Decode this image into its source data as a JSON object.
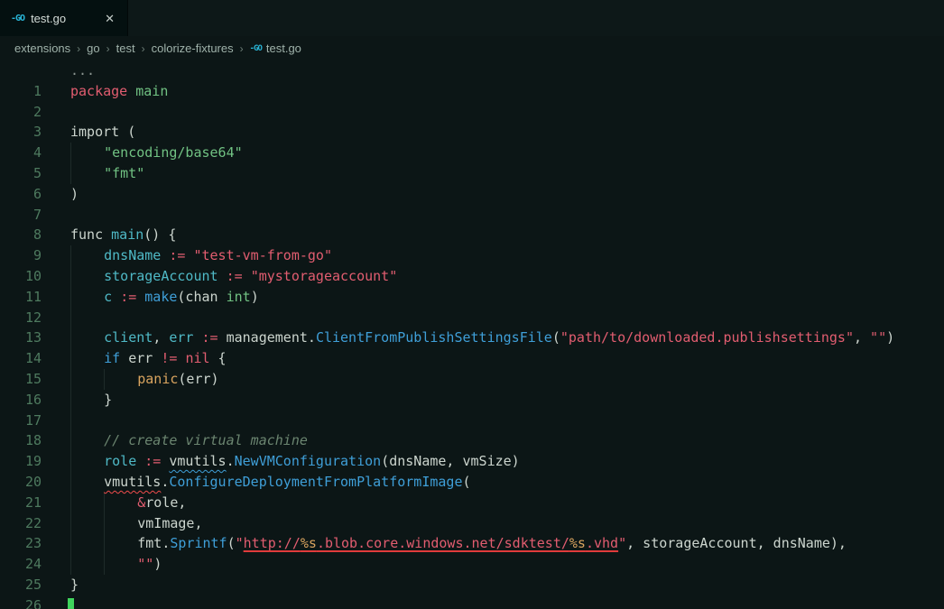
{
  "tab": {
    "title": "test.go",
    "close_glyph": "✕"
  },
  "icons": {
    "go_glyph": "-GO"
  },
  "breadcrumb": {
    "items": [
      "extensions",
      "go",
      "test",
      "colorize-fixtures"
    ],
    "file": "test.go",
    "separator": "›"
  },
  "colors": {
    "editor_bg": "#0c1616",
    "tab_bg": "#041010",
    "go_brand": "#29b6d8",
    "keyword_red": "#e25d70",
    "string_red": "#e25d70",
    "green": "#71c283",
    "teal_variable": "#4fb9c6",
    "blue_function": "#3f9fd8",
    "orange": "#d9a45f",
    "comment": "#6b8570",
    "line_number": "#4e7a5f",
    "error_squiggle": "#f14c4c",
    "cursor": "#3fd35c"
  },
  "editor": {
    "language": "go",
    "lines": [
      {
        "n": "",
        "t": [
          [
            "dim",
            "..."
          ]
        ]
      },
      {
        "n": "1",
        "t": [
          [
            "red",
            "package"
          ],
          [
            "pln",
            " "
          ],
          [
            "grn",
            "main"
          ]
        ]
      },
      {
        "n": "2",
        "t": []
      },
      {
        "n": "3",
        "t": [
          [
            "pln",
            "import ("
          ]
        ]
      },
      {
        "n": "4",
        "t": [
          [
            "ig",
            "    "
          ],
          [
            "grn",
            "\"encoding/base64\""
          ]
        ]
      },
      {
        "n": "5",
        "t": [
          [
            "ig",
            "    "
          ],
          [
            "grn",
            "\"fmt\""
          ]
        ]
      },
      {
        "n": "6",
        "t": [
          [
            "pln",
            ")"
          ]
        ]
      },
      {
        "n": "7",
        "t": []
      },
      {
        "n": "8",
        "t": [
          [
            "pln",
            "func "
          ],
          [
            "teal",
            "main"
          ],
          [
            "pln",
            "() {"
          ]
        ]
      },
      {
        "n": "9",
        "t": [
          [
            "ig",
            "    "
          ],
          [
            "teal",
            "dnsName"
          ],
          [
            "pln",
            " "
          ],
          [
            "red",
            ":="
          ],
          [
            "pln",
            " "
          ],
          [
            "str",
            "\"test-vm-from-go\""
          ]
        ]
      },
      {
        "n": "10",
        "t": [
          [
            "ig",
            "    "
          ],
          [
            "teal",
            "storageAccount"
          ],
          [
            "pln",
            " "
          ],
          [
            "red",
            ":="
          ],
          [
            "pln",
            " "
          ],
          [
            "str",
            "\"mystorageaccount\""
          ]
        ]
      },
      {
        "n": "11",
        "t": [
          [
            "ig",
            "    "
          ],
          [
            "teal",
            "c"
          ],
          [
            "pln",
            " "
          ],
          [
            "red",
            ":="
          ],
          [
            "pln",
            " "
          ],
          [
            "blue",
            "make"
          ],
          [
            "pln",
            "(chan "
          ],
          [
            "grn",
            "int"
          ],
          [
            "pln",
            ")"
          ]
        ]
      },
      {
        "n": "12",
        "t": [
          [
            "ig",
            "    "
          ]
        ]
      },
      {
        "n": "13",
        "t": [
          [
            "ig",
            "    "
          ],
          [
            "teal",
            "client"
          ],
          [
            "pln",
            ", "
          ],
          [
            "teal",
            "err"
          ],
          [
            "pln",
            " "
          ],
          [
            "red",
            ":="
          ],
          [
            "pln",
            " management."
          ],
          [
            "blue",
            "ClientFromPublishSettingsFile"
          ],
          [
            "pln",
            "("
          ],
          [
            "str",
            "\"path/to/downloaded.publishsettings\""
          ],
          [
            "pln",
            ", "
          ],
          [
            "str",
            "\"\""
          ],
          [
            "pln",
            ")"
          ]
        ]
      },
      {
        "n": "14",
        "t": [
          [
            "ig",
            "    "
          ],
          [
            "blue",
            "if"
          ],
          [
            "pln",
            " err "
          ],
          [
            "red",
            "!="
          ],
          [
            "pln",
            " "
          ],
          [
            "red",
            "nil"
          ],
          [
            "pln",
            " {"
          ]
        ]
      },
      {
        "n": "15",
        "t": [
          [
            "ig",
            "    "
          ],
          [
            "ig",
            "    "
          ],
          [
            "org",
            "panic"
          ],
          [
            "pln",
            "(err)"
          ]
        ]
      },
      {
        "n": "16",
        "t": [
          [
            "ig",
            "    "
          ],
          [
            "pln",
            "}"
          ]
        ]
      },
      {
        "n": "17",
        "t": [
          [
            "ig",
            "    "
          ]
        ]
      },
      {
        "n": "18",
        "t": [
          [
            "ig",
            "    "
          ],
          [
            "cmt",
            "// create virtual machine"
          ]
        ]
      },
      {
        "n": "19",
        "t": [
          [
            "ig",
            "    "
          ],
          [
            "teal",
            "role"
          ],
          [
            "pln",
            " "
          ],
          [
            "red",
            ":="
          ],
          [
            "pln",
            " "
          ],
          [
            "sqb",
            "vmutils"
          ],
          [
            "pln",
            "."
          ],
          [
            "blue",
            "NewVMConfiguration"
          ],
          [
            "pln",
            "(dnsName, vmSize)"
          ]
        ]
      },
      {
        "n": "20",
        "t": [
          [
            "ig",
            "    "
          ],
          [
            "sqr",
            "vmutils"
          ],
          [
            "pln",
            "."
          ],
          [
            "blue",
            "ConfigureDeploymentFromPlatformImage"
          ],
          [
            "pln",
            "("
          ]
        ]
      },
      {
        "n": "21",
        "t": [
          [
            "ig",
            "    "
          ],
          [
            "ig",
            "    "
          ],
          [
            "red",
            "&"
          ],
          [
            "pln",
            "role,"
          ]
        ]
      },
      {
        "n": "22",
        "t": [
          [
            "ig",
            "    "
          ],
          [
            "ig",
            "    "
          ],
          [
            "pln",
            "vmImage,"
          ]
        ]
      },
      {
        "n": "23",
        "t": [
          [
            "ig",
            "    "
          ],
          [
            "ig",
            "    "
          ],
          [
            "pln",
            "fmt."
          ],
          [
            "blue",
            "Sprintf"
          ],
          [
            "pln",
            "("
          ],
          [
            "str",
            "\""
          ],
          [
            "stru",
            "http://"
          ],
          [
            "orgu",
            "%s"
          ],
          [
            "stru",
            ".blob.core.windows.net/sdktest/"
          ],
          [
            "orgu",
            "%s"
          ],
          [
            "stru",
            ".vhd"
          ],
          [
            "str",
            "\""
          ],
          [
            "pln",
            ", storageAccount, dnsName),"
          ]
        ]
      },
      {
        "n": "24",
        "t": [
          [
            "ig",
            "    "
          ],
          [
            "ig",
            "    "
          ],
          [
            "str",
            "\"\""
          ],
          [
            "pln",
            ")"
          ]
        ]
      },
      {
        "n": "25",
        "t": [
          [
            "pln",
            "}"
          ]
        ]
      },
      {
        "n": "26",
        "t": [
          [
            "cur",
            ""
          ]
        ]
      }
    ]
  }
}
